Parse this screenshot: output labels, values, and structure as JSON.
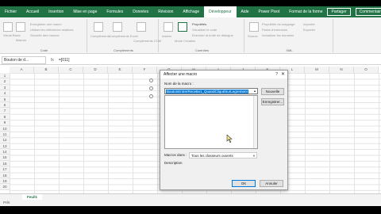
{
  "ribbon": {
    "tabs": [
      "Fichier",
      "Accueil",
      "Insertion",
      "Mise en page",
      "Formules",
      "Données",
      "Révision",
      "Affichage",
      "Développeur",
      "Aide",
      "Power Pivot",
      "Format de la forme"
    ],
    "active_tab": "Développeur",
    "share_label": "Partager",
    "comments_label": "Commentaires",
    "groups": [
      {
        "label": "Code",
        "items": [
          "Visual Basic",
          "Macros",
          "Enregistrer une macro",
          "Utiliser les références relatives",
          "Sécurité des macros"
        ]
      },
      {
        "label": "Compléments",
        "items": [
          "Compléments",
          "Compléments Excel",
          "Compléments COM"
        ]
      },
      {
        "label": "Contrôles",
        "items": [
          "Insérer",
          "Mode Création",
          "Propriétés",
          "Visualiser le code",
          "Exécuter la boîte de dialogue"
        ]
      },
      {
        "label": "XML",
        "items": [
          "Source",
          "Propriétés du mappage",
          "Packs d'extension",
          "Actualiser les données",
          "Importer",
          "Exporter"
        ]
      }
    ]
  },
  "formula_bar": {
    "name_box": "Bouton de d...",
    "fx": "fx",
    "formula": "=[011]"
  },
  "sheet": {
    "columns": [
      "A",
      "B",
      "C",
      "D",
      "E",
      "F",
      "G",
      "H",
      "I",
      "J",
      "K",
      "L",
      "M",
      "N",
      "O"
    ],
    "rows": [
      "1",
      "2",
      "3",
      "4",
      "5",
      "6",
      "7",
      "8",
      "9",
      "10",
      "11",
      "12",
      "13",
      "14",
      "15",
      "16",
      "17",
      "18",
      "19",
      "20"
    ],
    "active_sheet": "Feuil1",
    "status": "Prêt"
  },
  "dialog": {
    "title": "Affecter une macro",
    "help": "?",
    "close": "✕",
    "macro_name_label": "Nom de la macro :",
    "macro_name_value": "BoutonEntrerRecette1_QuandCliquéSurLegrement",
    "new_button": "Nouvelle",
    "record_button": "Enregistrer...",
    "macros_in_label": "Macros dans :",
    "macros_in_value": "Tous les classeurs ouverts",
    "description_label": "Description",
    "ok_button": "OK",
    "cancel_button": "Annuler"
  }
}
